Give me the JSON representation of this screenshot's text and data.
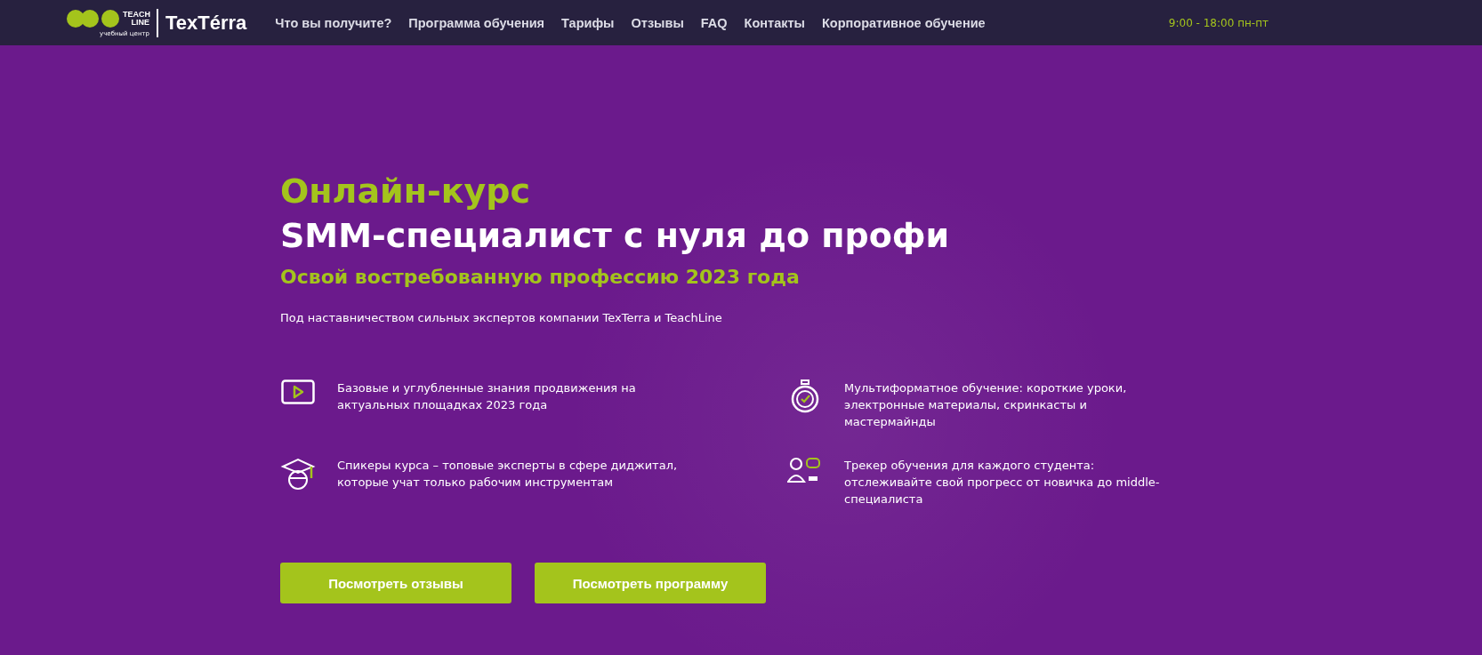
{
  "header": {
    "logo": {
      "teach_line": "TEACH LINE",
      "subtitle": "учебный центр",
      "brand": "TexTérra"
    },
    "nav": [
      "Что вы получите?",
      "Программа обучения",
      "Тарифы",
      "Отзывы",
      "FAQ",
      "Контакты",
      "Корпоративное обучение"
    ],
    "hours": "9:00 - 18:00 пн-пт"
  },
  "hero": {
    "kicker": "Онлайн-курс",
    "title": "SMM-специалист с нуля до профи",
    "subtitle": "Освой востребованную профессию 2023 года",
    "description": "Под наставничеством сильных экспертов компании TexTerra и TeachLine",
    "features": [
      {
        "kind": "video",
        "text": "Базовые и углубленные знания продвижения на актуальных площадках 2023 года"
      },
      {
        "kind": "stopwatch",
        "text": "Мультиформатное обучение: короткие уроки, электронные материалы, скринкасты и мастермайнды"
      },
      {
        "kind": "graduate",
        "text": "Спикеры курса – топовые эксперты в сфере диджитал, которые учат только рабочим инструментам"
      },
      {
        "kind": "tracker",
        "text": "Трекер обучения для каждого студента: отслеживайте свой прогресс от новичка до middle-специалиста"
      }
    ],
    "buttons": [
      "Посмотреть отзывы",
      "Посмотреть программу"
    ]
  }
}
